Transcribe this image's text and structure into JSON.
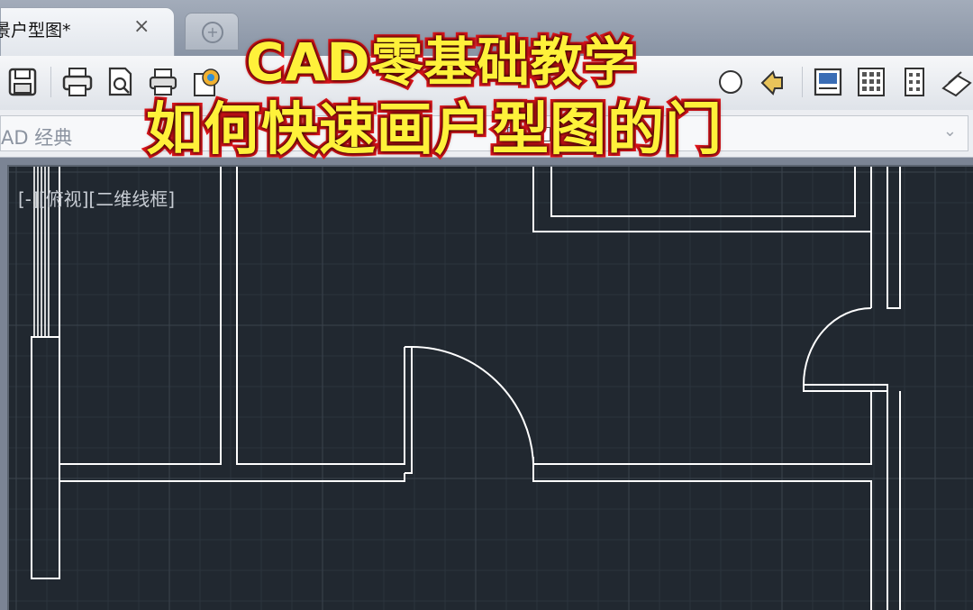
{
  "tabs": {
    "active_label": "户型图*",
    "active_label_prefix": "景",
    "close_glyph": "×",
    "new_tab_glyph": "+"
  },
  "toolbar": {
    "buttons": [
      "save-icon",
      "print-icon",
      "print-preview-icon",
      "plot-icon",
      "publish-icon",
      "match-properties-icon",
      "design-center-icon",
      "properties-palette-icon",
      "tool-palettes-icon",
      "sheet-set-icon",
      "markup-icon"
    ]
  },
  "workspace": {
    "label": "AD 经典",
    "arrow_glyph": "⌄"
  },
  "viewport": {
    "label": "[-][俯视][二维线框]"
  },
  "overlay": {
    "title_line1": "CAD零基础教学",
    "title_line2": "如何快速画户型图的门",
    "text_color": "#fff13a",
    "outline_color": "#e0151b"
  },
  "colors": {
    "canvas_bg": "#212830",
    "grid_minor": "#2c343d",
    "grid_major": "#3a434d",
    "line_color": "#ffffff"
  }
}
